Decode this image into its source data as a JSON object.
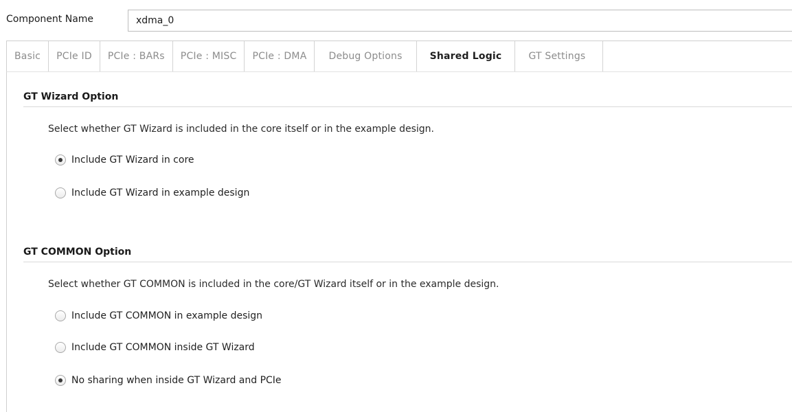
{
  "component": {
    "label": "Component Name",
    "value": "xdma_0"
  },
  "tabs": [
    {
      "label": "Basic",
      "active": false
    },
    {
      "label": "PCIe ID",
      "active": false
    },
    {
      "label": "PCIe : BARs",
      "active": false
    },
    {
      "label": "PCIe : MISC",
      "active": false
    },
    {
      "label": "PCIe : DMA",
      "active": false
    },
    {
      "label": "Debug Options",
      "active": false
    },
    {
      "label": "Shared Logic",
      "active": true
    },
    {
      "label": "GT Settings",
      "active": false
    }
  ],
  "gt_wizard": {
    "title": "GT Wizard Option",
    "description": "Select whether GT Wizard is included in the core itself or in the example design.",
    "options": [
      {
        "label": "Include GT Wizard in core",
        "selected": true
      },
      {
        "label": "Include GT Wizard in example design",
        "selected": false
      }
    ]
  },
  "gt_common": {
    "title": "GT COMMON Option",
    "description": "Select whether GT COMMON is included in the core/GT Wizard itself or in the example design.",
    "options": [
      {
        "label": "Include GT COMMON in example design",
        "selected": false
      },
      {
        "label": "Include GT COMMON inside GT Wizard",
        "selected": false
      },
      {
        "label": "No sharing when inside GT Wizard and PCIe",
        "selected": true
      }
    ]
  }
}
